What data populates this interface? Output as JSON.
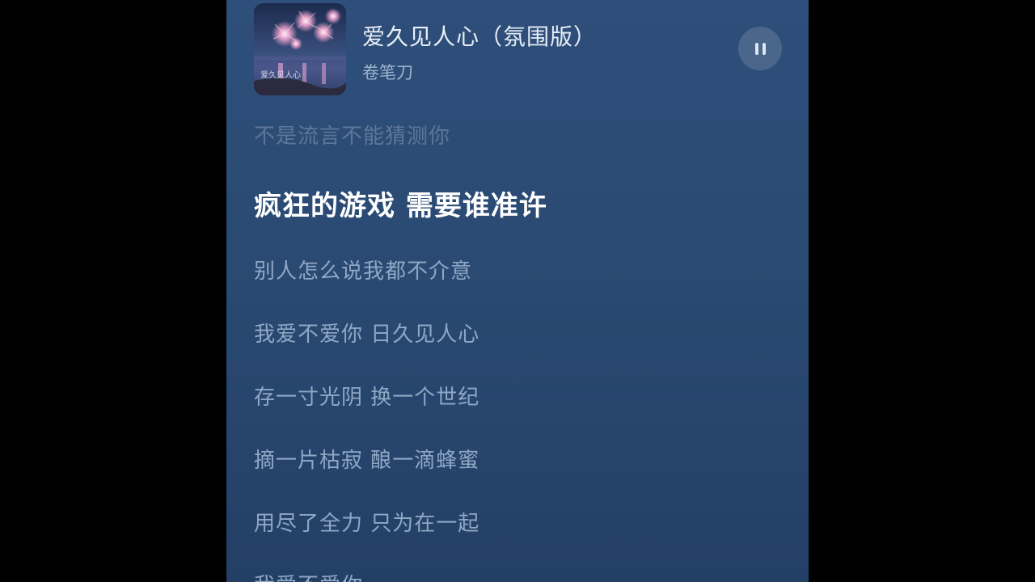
{
  "player": {
    "song_title": "爱久见人心（氛围版）",
    "artist": "卷笔刀",
    "cover_art_text": "爱久见人心",
    "playback_state": "playing",
    "control_icon": "pause-icon"
  },
  "lyrics": {
    "previous": "不是流言不能猜测你",
    "current": "疯狂的游戏 需要谁准许",
    "upcoming": [
      "别人怎么说我都不介意",
      "我爱不爱你 日久见人心",
      "存一寸光阴 换一个世纪",
      "摘一片枯寂 酿一滴蜂蜜",
      "用尽了全力 只为在一起",
      "我爱不爱你"
    ]
  },
  "colors": {
    "background": "#2a4a73",
    "current_lyric": "#ffffff",
    "upcoming_lyric": "#8fa7c6",
    "previous_lyric": "#5d7699"
  }
}
